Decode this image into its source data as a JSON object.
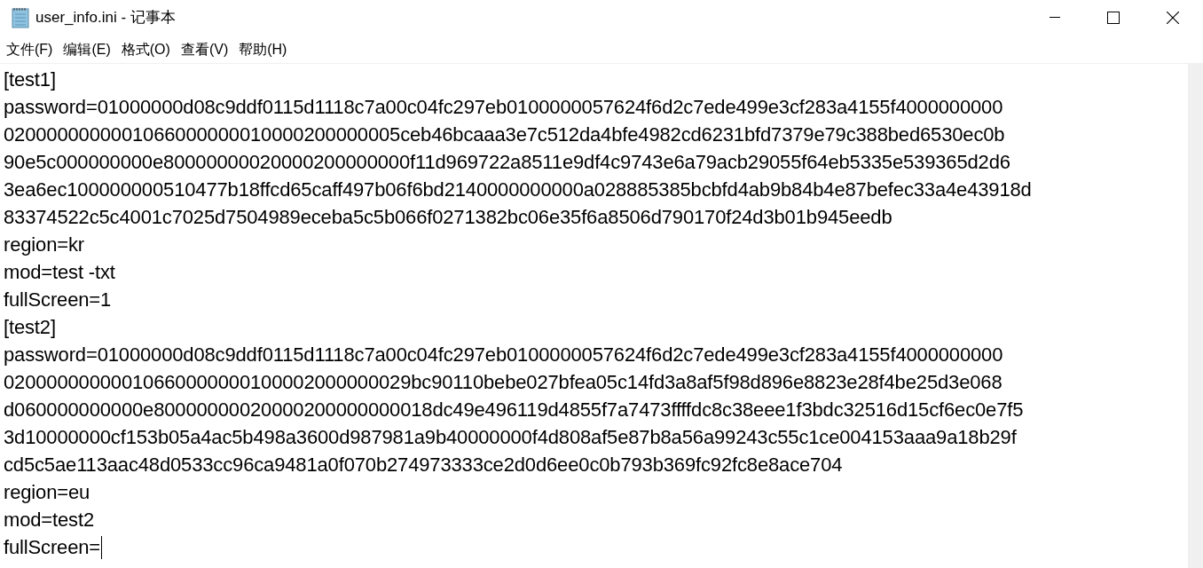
{
  "window": {
    "title": "user_info.ini - 记事本"
  },
  "menu": [
    "文件(F)",
    "编辑(E)",
    "格式(O)",
    "查看(V)",
    "帮助(H)"
  ],
  "editor": {
    "lines": [
      "[test1]",
      "password=01000000d08c9ddf0115d1118c7a00c04fc297eb0100000057624f6d2c7ede499e3cf283a4155f4000000000",
      "0200000000001066000000010000200000005ceb46bcaaa3e7c512da4bfe4982cd6231bfd7379e79c388bed6530ec0b",
      "90e5c000000000e80000000020000200000000f11d969722a8511e9df4c9743e6a79acb29055f64eb5335e539365d2d6",
      "3ea6ec100000000510477b18ffcd65caff497b06f6bd2140000000000a028885385bcbfd4ab9b84b4e87befec33a4e43918d",
      "83374522c5c4001c7025d7504989eceba5c5b066f0271382bc06e35f6a8506d790170f24d3b01b945eedb",
      "region=kr",
      "mod=test -txt",
      "fullScreen=1",
      "[test2]",
      "password=01000000d08c9ddf0115d1118c7a00c04fc297eb0100000057624f6d2c7ede499e3cf283a4155f4000000000",
      "02000000000010660000000100002000000029bc90110bebe027bfea05c14fd3a8af5f98d896e8823e28f4be25d3e068",
      "d060000000000e80000000020000200000000018dc49e496119d4855f7a7473ffffdc8c38eee1f3bdc32516d15cf6ec0e7f5",
      "3d10000000cf153b05a4ac5b498a3600d987981a9b40000000f4d808af5e87b8a56a99243c55c1ce004153aaa9a18b29f",
      "cd5c5ae113aac48d0533cc96ca9481a0f070b274973333ce2d0d6ee0c0b793b369fc92fc8e8ace704",
      "region=eu",
      "mod=test2",
      "fullScreen="
    ]
  }
}
